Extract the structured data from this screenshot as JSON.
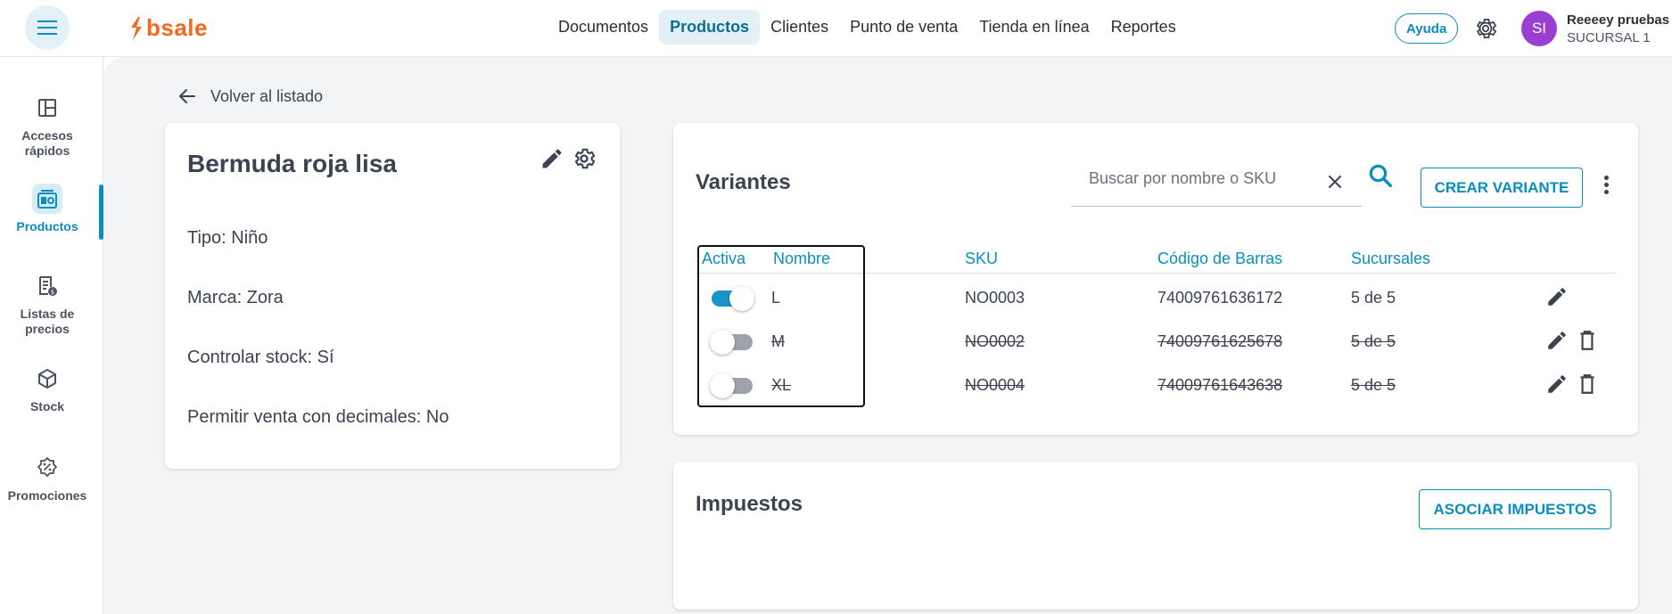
{
  "header": {
    "logo_text": "bsale",
    "nav": [
      "Documentos",
      "Productos",
      "Clientes",
      "Punto de venta",
      "Tienda en línea",
      "Reportes"
    ],
    "active_nav": "Productos",
    "help_label": "Ayuda",
    "avatar_initials": "SI",
    "user_name": "Reeeey pruebas",
    "user_branch": "SUCURSAL 1"
  },
  "sidebar": {
    "items": [
      {
        "label": "Accesos rápidos",
        "icon": "layout-icon"
      },
      {
        "label": "Productos",
        "icon": "products-icon",
        "active": true
      },
      {
        "label": "Listas de precios",
        "icon": "price-list-icon"
      },
      {
        "label": "Stock",
        "icon": "box-icon"
      },
      {
        "label": "Promociones",
        "icon": "promo-icon"
      }
    ]
  },
  "back": {
    "label": "Volver al listado"
  },
  "product": {
    "title": "Bermuda roja lisa",
    "tipo": "Tipo: Niño",
    "marca": "Marca: Zora",
    "stock": "Controlar stock: Sí",
    "decimales": "Permitir venta con decimales: No"
  },
  "variants": {
    "title": "Variantes",
    "search_placeholder": "Buscar por nombre o SKU",
    "create_label": "CREAR VARIANTE",
    "columns": [
      "Activa",
      "Nombre",
      "SKU",
      "Código de Barras",
      "Sucursales"
    ],
    "rows": [
      {
        "active": true,
        "name": "L",
        "sku": "NO0003",
        "barcode": "74009761636172",
        "branches": "5 de 5"
      },
      {
        "active": false,
        "name": "M",
        "sku": "NO0002",
        "barcode": "74009761625678",
        "branches": "5 de 5"
      },
      {
        "active": false,
        "name": "XL",
        "sku": "NO0004",
        "barcode": "74009761643638",
        "branches": "5 de 5"
      }
    ]
  },
  "taxes": {
    "title": "Impuestos",
    "button_label": "ASOCIAR IMPUESTOS"
  },
  "colors": {
    "accent": "#0a8ebf",
    "brand": "#f26a21",
    "avatar": "#9b3fd1"
  }
}
